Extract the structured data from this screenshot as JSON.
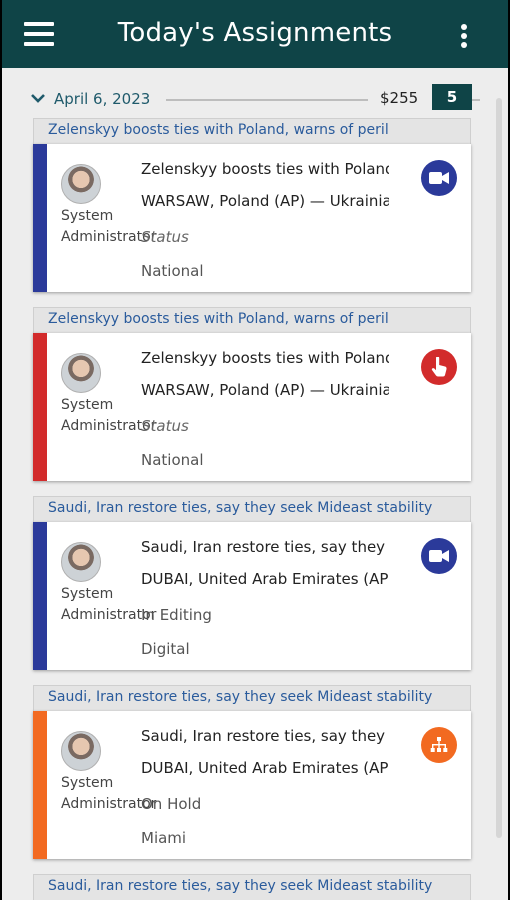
{
  "header": {
    "title": "Today's Assignments",
    "menu_icon": "hamburger-menu-icon",
    "more_icon": "more-vertical-icon"
  },
  "date_group": {
    "date": "April 6, 2023",
    "amount": "$255",
    "count": "5"
  },
  "colors": {
    "appbar": "#0f4447",
    "blue": "#2b3a9a",
    "red": "#d22b2b",
    "orange": "#f26a21",
    "link": "#2a5b9c"
  },
  "cards": [
    {
      "group_title": "Zelenskyy boosts ties with Poland, warns of peril",
      "author_line1": "System",
      "author_line2": "Administrator",
      "headline": "Zelenskyy boosts ties with Poland, warns of peril",
      "dateline": "WARSAW, Poland (AP) — Ukrainian",
      "status": "Status",
      "desk": "National",
      "icon": "video-camera-icon",
      "color": "#2b3a9a"
    },
    {
      "group_title": "Zelenskyy boosts ties with Poland, warns of peril",
      "author_line1": "System",
      "author_line2": "Administrator",
      "headline": "Zelenskyy boosts ties with Poland, warns of peril",
      "dateline": "WARSAW, Poland (AP) — Ukrainian",
      "status": "Status",
      "desk": "National",
      "icon": "hand-pointer-icon",
      "color": "#d22b2b"
    },
    {
      "group_title": "Saudi, Iran restore ties, say they seek Mideast stability",
      "author_line1": "System",
      "author_line2": "Administrator",
      "headline": "Saudi, Iran restore ties, say they seek",
      "dateline": "DUBAI, United Arab Emirates (AP)",
      "status": "In Editing",
      "desk": "Digital",
      "icon": "video-camera-icon",
      "color": "#2b3a9a"
    },
    {
      "group_title": "Saudi, Iran restore ties, say they seek Mideast stability",
      "author_line1": "System",
      "author_line2": "Administrator",
      "headline": "Saudi, Iran restore ties, say they seek",
      "dateline": "DUBAI, United Arab Emirates (AP)",
      "status": "On Hold",
      "desk": "Miami",
      "icon": "org-chart-icon",
      "color": "#f26a21"
    },
    {
      "group_title": "Saudi, Iran restore ties, say they seek Mideast stability"
    }
  ]
}
